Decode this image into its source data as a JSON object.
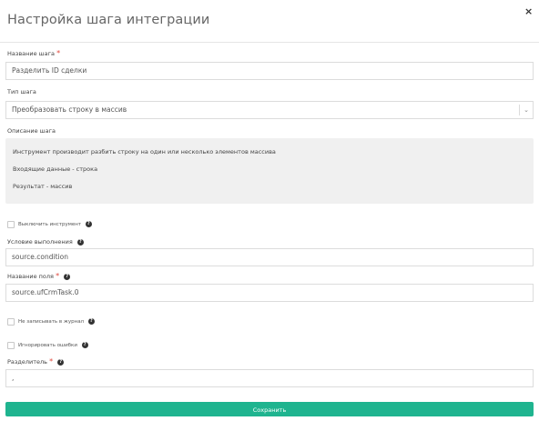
{
  "dialog": {
    "title": "Настройка шага интеграции",
    "close_glyph": "×"
  },
  "step_name": {
    "label": "Название шага",
    "required_mark": "*",
    "value": "Разделить ID сделки"
  },
  "step_type": {
    "label": "Тип шага",
    "selected": "Преобразовать строку в массив",
    "arrow_icon": "chevron-down-icon"
  },
  "description": {
    "label": "Описание шага",
    "lines": [
      "Инструмент производит разбить строку на один или несколько элементов массива",
      "Входящие данные - строка",
      "Результат - массив"
    ]
  },
  "disable_tool": {
    "label": "Выключить инструмент",
    "checked": false
  },
  "condition": {
    "label": "Условие выполнения",
    "value": "source.condition"
  },
  "field_name": {
    "label": "Название поля",
    "required_mark": "*",
    "value": "source.ufCrmTask.0"
  },
  "no_log": {
    "label": "Не записывать в журнал",
    "checked": false
  },
  "ignore_errors": {
    "label": "Игнорировать ошибки",
    "checked": false
  },
  "separator": {
    "label": "Разделитель",
    "required_mark": "*",
    "value": ","
  },
  "help_glyph": "?",
  "save_button": {
    "label": "Сохранить",
    "color": "#1fb48f"
  }
}
